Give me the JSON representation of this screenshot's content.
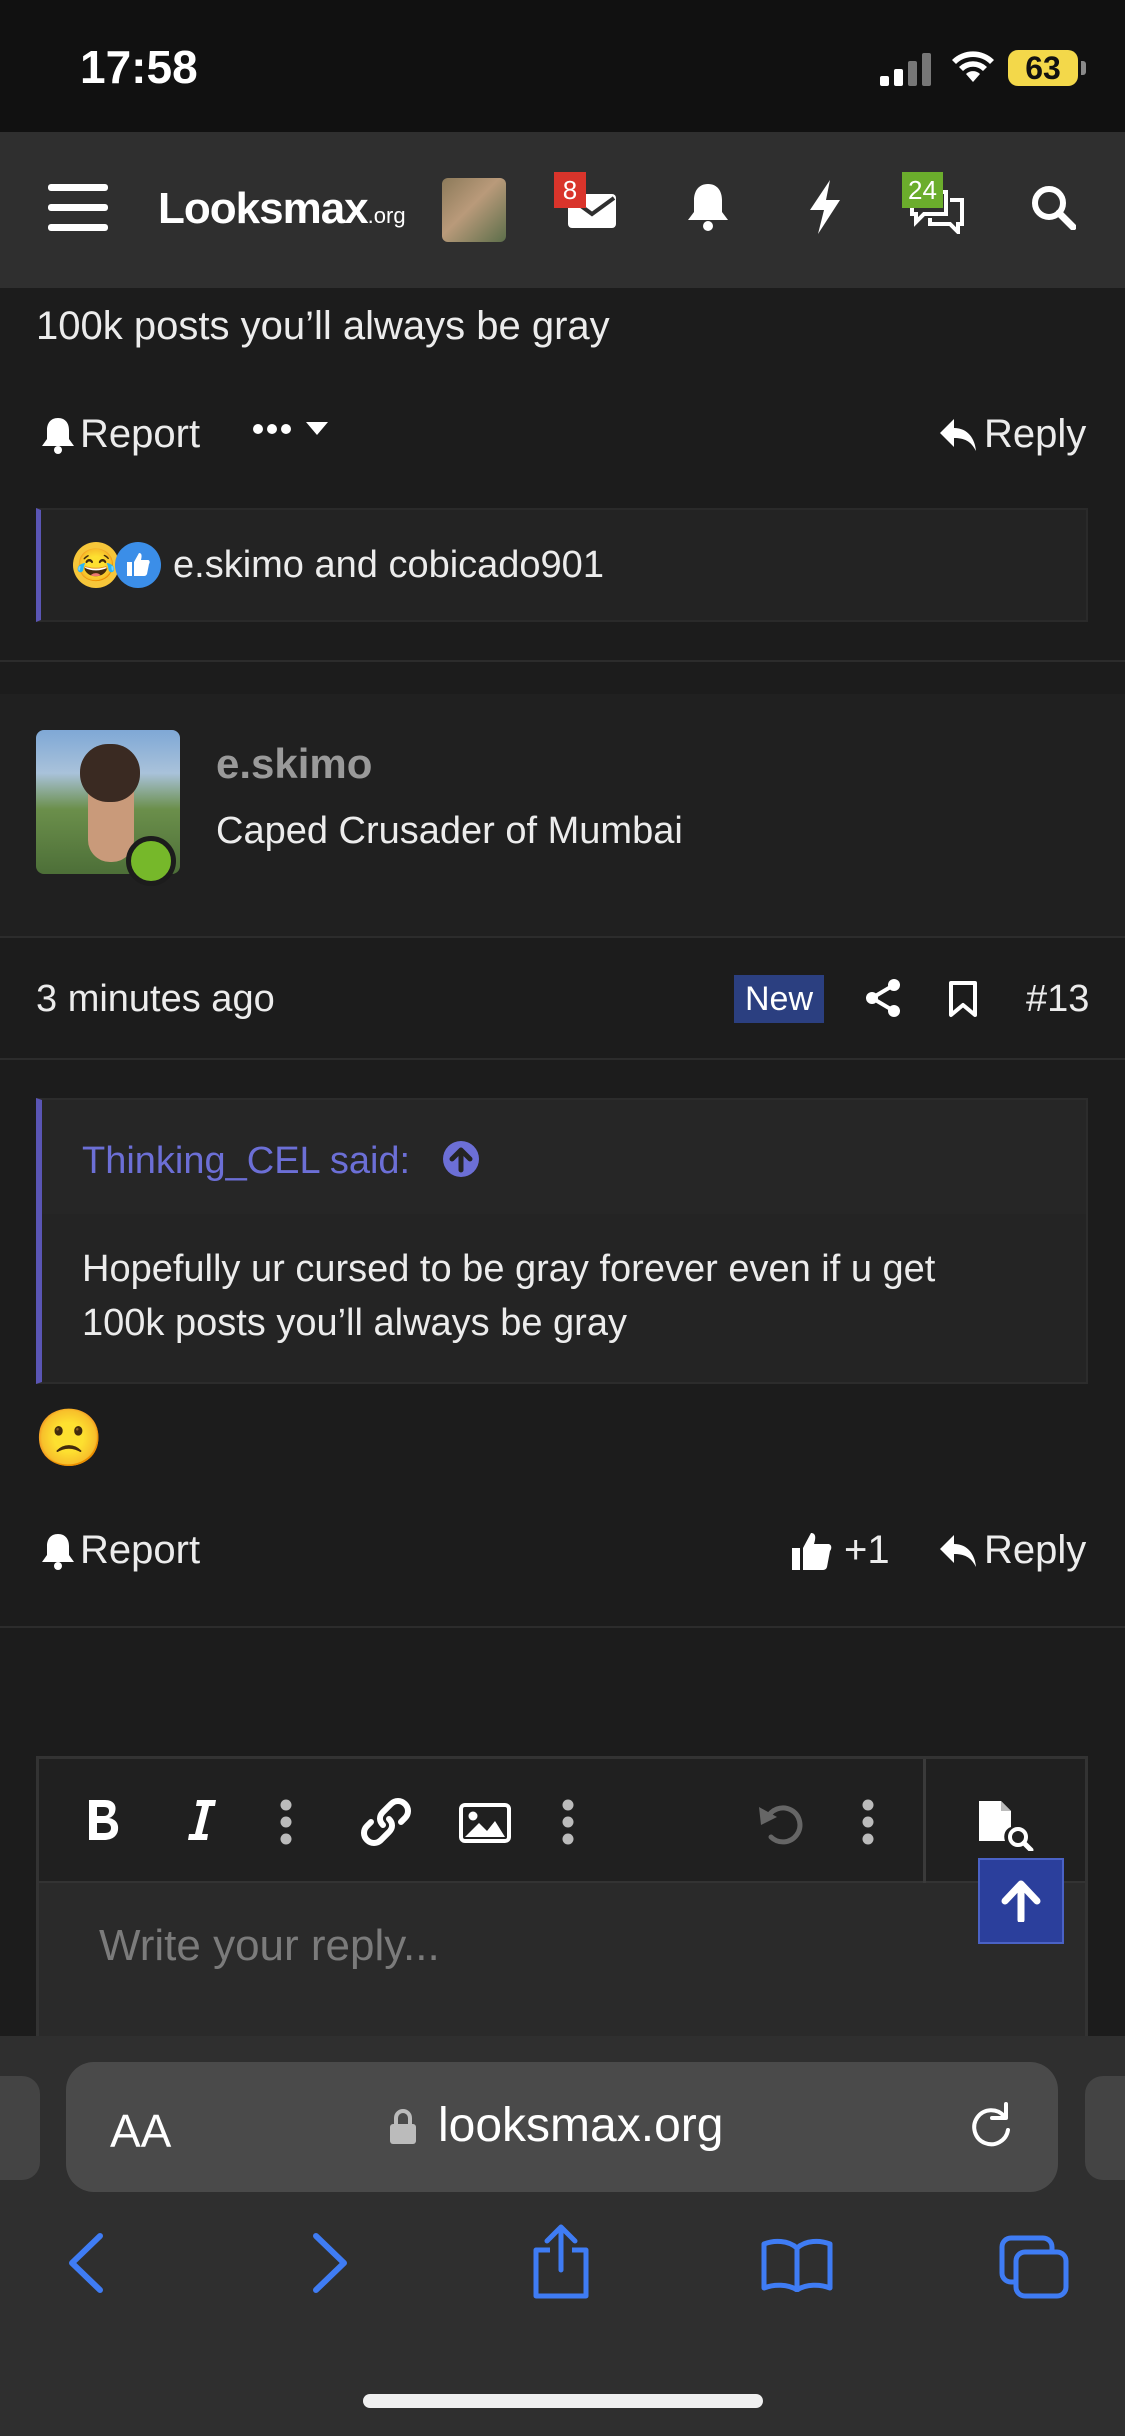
{
  "status": {
    "time": "17:58",
    "battery": "63"
  },
  "nav": {
    "logo_main": "Looksmax",
    "logo_tld": ".org",
    "inbox_badge": "8",
    "whatsnew_badge": "24"
  },
  "prev_post": {
    "text_tail": "100k posts you’ll always be gray",
    "report": "Report",
    "reply": "Reply",
    "reactions_label": "e.skimo and cobicado901"
  },
  "post": {
    "username": "e.skimo",
    "user_title": "Caped Crusader of Mumbai",
    "time": "3 minutes ago",
    "new_badge": "New",
    "post_number": "#13",
    "quote_author": "Thinking_CEL said:",
    "quote_line1": "Hopefully ur cursed to be gray forever even if u get",
    "quote_line2": "100k posts you’ll always be gray",
    "emoji": "🙁",
    "report": "Report",
    "like_count": "+1",
    "reply": "Reply"
  },
  "editor": {
    "placeholder": "Write your reply..."
  },
  "safari": {
    "aa": "AA",
    "url": "looksmax.org"
  },
  "colors": {
    "accent": "#5a55b4",
    "online": "#76b82a",
    "new_badge": "#2b3f80",
    "link": "#6c6fd6",
    "safari_blue": "#3f7cf4"
  }
}
